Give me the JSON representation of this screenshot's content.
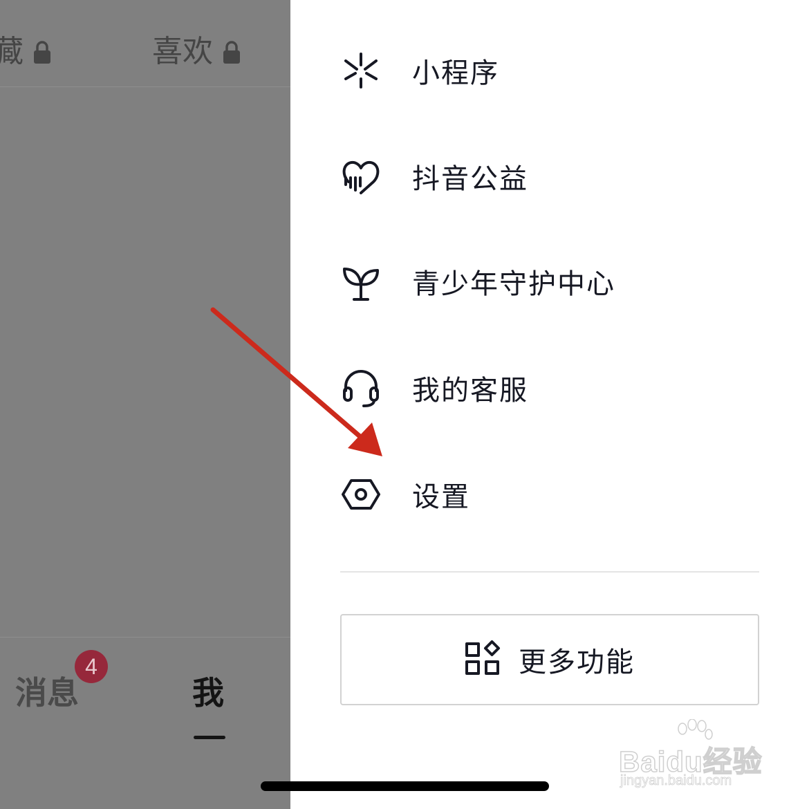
{
  "left_panel": {
    "tabs": [
      {
        "label": "藏",
        "locked": true
      },
      {
        "label": "喜欢",
        "locked": true
      }
    ],
    "bottom_nav": {
      "messages_label": "消息",
      "messages_badge": "4",
      "me_label": "我"
    }
  },
  "menu": {
    "items": [
      {
        "label": "小程序",
        "icon": "mini-program-icon"
      },
      {
        "label": "抖音公益",
        "icon": "charity-heart-icon"
      },
      {
        "label": "青少年守护中心",
        "icon": "sprout-icon"
      },
      {
        "label": "我的客服",
        "icon": "headset-icon"
      },
      {
        "label": "设置",
        "icon": "settings-hexagon-icon"
      }
    ],
    "more_button": {
      "label": "更多功能",
      "icon": "grid-apps-icon"
    }
  },
  "annotation": {
    "type": "arrow",
    "color": "#cc2a1c"
  },
  "watermark": {
    "main": "Baidu经验",
    "sub": "jingyan.baidu.com"
  }
}
